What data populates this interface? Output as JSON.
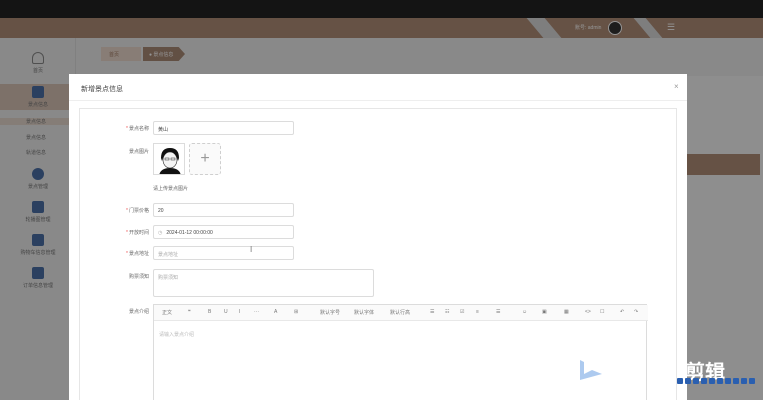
{
  "header": {
    "user": "账号: admin"
  },
  "sidebar": {
    "items": [
      {
        "label": "首页"
      },
      {
        "label": "景点信息"
      },
      {
        "label": "景点管理"
      },
      {
        "label": "轮播图管理"
      },
      {
        "label": "购物车信息管理"
      },
      {
        "label": "订单信息管理"
      }
    ],
    "subs": [
      "景点信息",
      "景点信息",
      "轨道信息"
    ]
  },
  "breadcrumb": {
    "home": "首页",
    "current": "● 景点信息"
  },
  "modal": {
    "title": "新增景点信息",
    "close": "×",
    "fields": {
      "name": {
        "label": "景点名称",
        "value": "黄山"
      },
      "image": {
        "label": "景点图片",
        "tip": "请上传景点图片"
      },
      "price": {
        "label": "门票价格",
        "value": "20"
      },
      "open_time": {
        "label": "开放时间",
        "value": "2024-01-12 00:00:00"
      },
      "address": {
        "label": "景点地址",
        "placeholder": "景点地址"
      },
      "notice": {
        "label": "购票须知",
        "placeholder": "购票须知"
      },
      "intro": {
        "label": "景点介绍",
        "placeholder": "请输入景点介绍"
      }
    },
    "editor_toolbar": [
      "正文",
      "❝",
      "B",
      "U",
      "I",
      "···",
      "A",
      "⊞",
      "默认字号",
      "默认字体",
      "默认行高",
      "☰",
      "☷",
      "☑",
      "≡",
      "☰",
      "☺",
      "▣",
      "▦",
      "<>",
      "☐",
      "↶",
      "↷"
    ]
  },
  "watermark": {
    "text": "剪辑"
  },
  "colors": {
    "accent": "#b08e78",
    "sidebar_active": "#d8c3b6",
    "required": "#e55"
  }
}
